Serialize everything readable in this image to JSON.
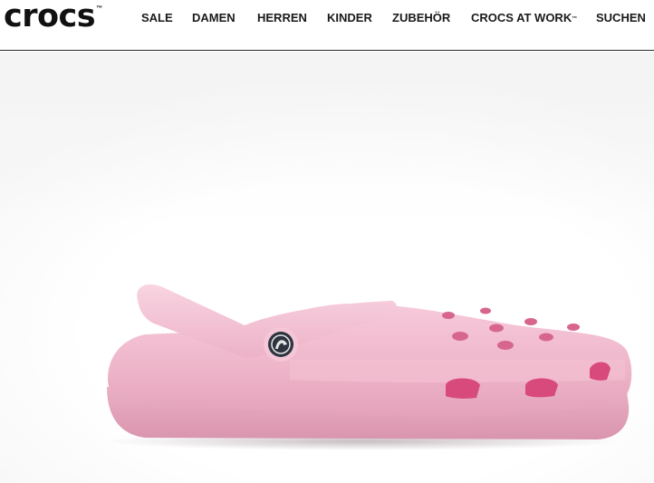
{
  "brand": {
    "logo_text": "crocs",
    "logo_mark": "™"
  },
  "nav": {
    "items": [
      {
        "label": "SALE"
      },
      {
        "label": "DAMEN"
      },
      {
        "label": "HERREN"
      },
      {
        "label": "KINDER"
      },
      {
        "label": "ZUBEHÖR"
      },
      {
        "label": "CROCS AT WORK",
        "mark": "™"
      },
      {
        "label": "SUCHEN"
      }
    ]
  },
  "hero": {
    "product_image": "pink-classic-clog",
    "colors": {
      "clog": "#f0b8cc",
      "clog_shadow": "#e3a3bb",
      "clog_highlight": "#f8d3e0",
      "vent_holes": "#d94a7c",
      "rivet": "#2d3440",
      "background": "#ffffff",
      "accent_text": "#1a1a1a"
    }
  }
}
